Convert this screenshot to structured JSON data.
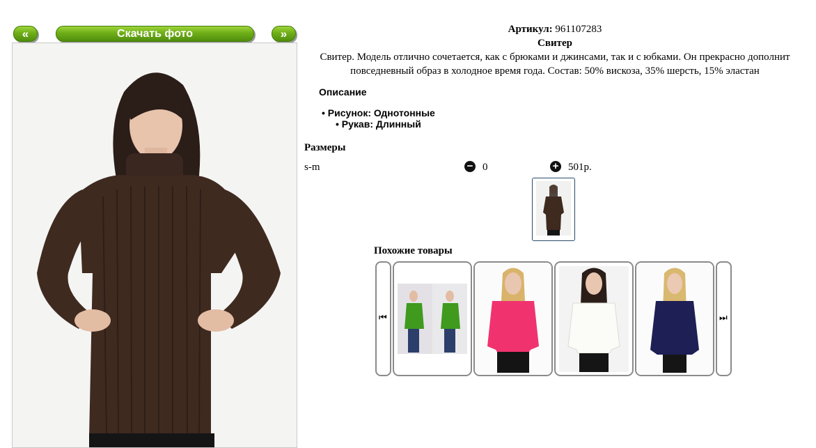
{
  "gallery": {
    "prev_label": "«",
    "next_label": "»",
    "download_label": "Скачать фото"
  },
  "product": {
    "sku_label": "Артикул:",
    "sku_value": "961107283",
    "name": "Свитер",
    "description": "Свитер. Модель отлично сочетается, как с брюками и джинсами, так и с юбками. Он прекрасно дополнит повседневный образ в холодное время года. Состав: 50% вискоза, 35% шерсть, 15% эластан"
  },
  "specs": {
    "heading": "Описание",
    "items": [
      {
        "text": "Рисунок: Однотонные"
      },
      {
        "text": "Рукав: Длинный"
      }
    ]
  },
  "sizes": {
    "heading": "Размеры",
    "rows": [
      {
        "name": "s-m",
        "quantity": "0",
        "price": "501р."
      }
    ]
  },
  "similar": {
    "heading": "Похожие товары",
    "items": [
      {
        "color": "#3f9a1e"
      },
      {
        "color": "#f0336f"
      },
      {
        "color": "#f4f4f0"
      },
      {
        "color": "#1d1f55"
      }
    ]
  },
  "icons": {
    "minus": "minus-circle-icon",
    "plus": "plus-circle-icon",
    "carousel_prev": "skip-back-icon",
    "carousel_next": "skip-forward-icon"
  },
  "colors": {
    "accent_green": "#6fae18",
    "sweater_brown": "#3f2a20"
  }
}
